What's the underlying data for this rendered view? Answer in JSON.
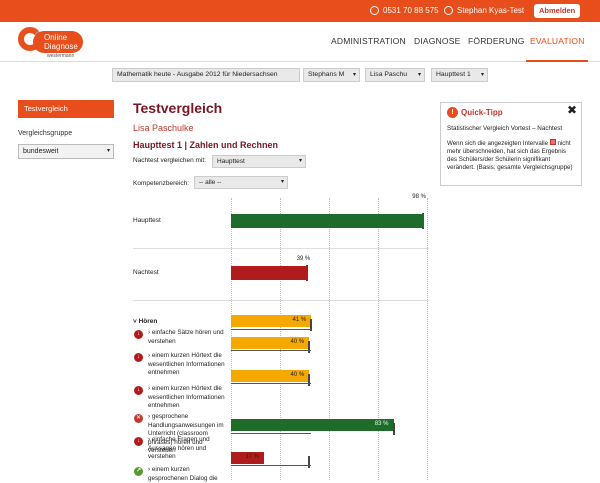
{
  "topbar": {
    "phone": "0531 70 88 575",
    "user": "Stephan Kyas-Test",
    "logout": "Abmelden"
  },
  "logo": {
    "line1": "Online",
    "line2": "Diagnose",
    "brand": "westermann"
  },
  "nav": {
    "items": [
      "ADMINISTRATION",
      "DIAGNOSE",
      "FÖRDERUNG",
      "EVALUATION"
    ],
    "active": "EVALUATION"
  },
  "filters": [
    "Mathematik heute - Ausgabe 2012 für Niedersachsen",
    "Stephans M",
    "Lisa Paschu",
    "Haupttest 1"
  ],
  "sidebar": {
    "active_item": "Testvergleich",
    "group_label": "Vergleichsgruppe",
    "group_value": "bundesweit"
  },
  "main": {
    "title": "Testvergleich",
    "student": "Lisa Paschulke",
    "test": "Haupttest 1 | Zahlen und Rechnen",
    "compare_label": "Nachtest vergleichen mit:",
    "compare_value": "Haupttest",
    "area_label": "Kompetenzbereich:",
    "area_value": "-- alle --"
  },
  "chart_data": {
    "type": "bar",
    "xlim": [
      0,
      100
    ],
    "rows": [
      {
        "label": "Haupttest",
        "value": 98,
        "value_label": "98 %",
        "color": "#1e6b2a"
      },
      {
        "label": "Nachtest",
        "value": 39,
        "value_label": "39 %",
        "color": "#b01c1c"
      }
    ],
    "section": "Hören",
    "items": [
      {
        "label": "einfache Sätze hören und verstehen",
        "value": 41,
        "value_label": "41 %",
        "color": "#f5a800",
        "status": "down",
        "compare": 41
      },
      {
        "label": "einem kurzen Hörtext die wesentlichen Informationen entnehmen",
        "value": 40,
        "value_label": "40 %",
        "color": "#f5a800",
        "status": "down",
        "compare": 40
      },
      {
        "label": "einem kurzen Hörtext die wesentlichen Informationen entnehmen",
        "value": 40,
        "value_label": "40 %",
        "color": "#f5a800",
        "status": "down",
        "compare": 40
      },
      {
        "label": "gesprochene Handlungsanweisungen im Unterricht (classroom phrases) hören und verstehen",
        "value": 83,
        "value_label": "83 %",
        "color": "#1e6b2a",
        "status": "cross",
        "compare": 0
      },
      {
        "label": "einfache Fragen und Aussagen hören und verstehen",
        "value": 17,
        "value_label": "17 %",
        "color": "#b01c1c",
        "status": "down",
        "compare": 40
      },
      {
        "label": "einem kurzen gesprochenen Dialog die",
        "value": 0,
        "value_label": "",
        "color": "#1e6b2a",
        "status": "up",
        "compare": 0
      }
    ]
  },
  "tip": {
    "title": "Quick-Tipp",
    "subtitle": "Statistischer Vergleich Vortest – Nachtest",
    "body_before": "Wenn sich die angezeigten Intervalle",
    "body_after": "nicht mehr überschneiden, hat sich das Ergebnis des Schülers/der Schülerin signifikant verändert. (Basis: gesamte Vergleichsgruppe)"
  }
}
